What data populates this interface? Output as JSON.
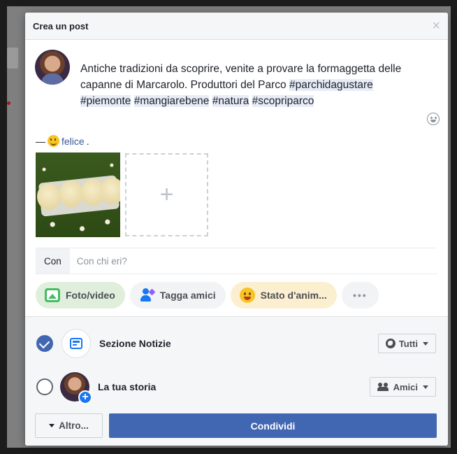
{
  "dialog": {
    "title": "Crea un post",
    "close_label": "×"
  },
  "post": {
    "text_plain": "Antiche tradizioni da scoprire, venite a provare la formaggetta delle capanne di Marcarolo. Produttori del Parco ",
    "hashtags": [
      "#parchidagustare",
      "#piemonte",
      "#mangiarebene",
      "#natura",
      "#scopriparco"
    ]
  },
  "feeling": {
    "dash": "—",
    "label": "felice",
    "suffix": "."
  },
  "media": {
    "add_label": "+"
  },
  "with": {
    "label": "Con",
    "placeholder": "Con chi eri?"
  },
  "actions": {
    "photo_video": "Foto/video",
    "tag_friends": "Tagga amici",
    "mood": "Stato d'anim...",
    "more": "•••"
  },
  "destinations": {
    "news_feed": {
      "label": "Sezione Notizie",
      "checked": true,
      "audience": "Tutti"
    },
    "story": {
      "label": "La tua storia",
      "checked": false,
      "audience": "Amici"
    }
  },
  "footer": {
    "more_label": "Altro...",
    "share_label": "Condividi"
  },
  "colors": {
    "brand": "#4267b2",
    "link": "#385898",
    "hashtag_bg": "#e7ecf7"
  }
}
